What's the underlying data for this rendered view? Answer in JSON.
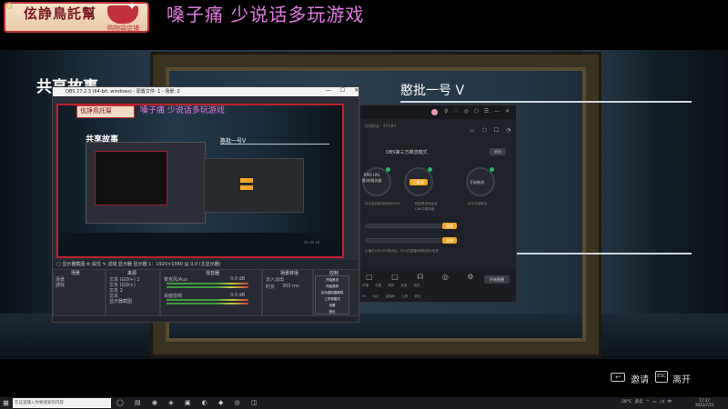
{
  "banner": {
    "logo_text": "伭諍鳥託幫",
    "logo_sub": "购物袋店铺",
    "title": "嗓子痛 少说话多玩游戏"
  },
  "scene": {
    "heading_left": "共享故事",
    "heading_right": "憨批一号 ᐯ"
  },
  "obs": {
    "title": "OBS 27.2.3 (64-bit, windows) - 配置文件: 1 - 场景: 2",
    "win_buttons": "— ☐ ✕",
    "preview": {
      "logo_text": "伭諍鳥託幫",
      "title": "嗓子痛 少说话多玩游戏",
      "heading_left": "共享故事",
      "heading_right": "憨批一号ᐯ",
      "buttons": "▭ ▭ ▭"
    },
    "toolbar_text": "▢ 显示器截图    ⚙ 属性   ✎ 滤镜   显示器   显示器 1：1920×1080 @ 0,0 (主显示器)",
    "docks": {
      "scenes": {
        "header": "场景",
        "items": [
          "场景",
          "游戏"
        ]
      },
      "sources": {
        "header": "来源",
        "items": [
          "文本 (GDI+) 2",
          "文本 (GDI+)",
          "文本 2",
          "文本",
          "显示器截图"
        ]
      },
      "mixer": {
        "header": "混音器",
        "items": [
          "麦克风/Aux",
          "桌面音频"
        ],
        "levels": [
          "0.0 dB",
          "0.0 dB"
        ]
      },
      "transitions": {
        "header": "场景转场",
        "items": [
          "淡入淡出",
          "时长",
          "300 ms"
        ]
      },
      "controls": {
        "header": "控制",
        "items": [
          "开始推流",
          "开始录制",
          "启动虚拟摄像机",
          "工作室模式",
          "设置",
          "退出"
        ]
      }
    }
  },
  "context_menu": {
    "items": [
      "开始推流",
      "开始录制",
      "启动虚拟摄像机",
      "工作室模式",
      "设置",
      "退出"
    ]
  },
  "game_assistant": {
    "title_icons": "♀ ♡ ◎ ⬡ ☰ — ✕",
    "sub": "在线好友 · 47/184",
    "sub_icons": "▭ ⬡ ☐ ◔ ⤴",
    "mode_text": "OBS第三方推流模式",
    "mode_btn": "退出",
    "circle1_t1": "RMS URL",
    "circle1_t2": "推流/服务器",
    "circle2_btn": "已复制",
    "circle3_t": "开始推流",
    "cap1": "点击复制推流地址到OBS",
    "cap2": "粘贴推流地址到",
    "cap3": "OBS中服务器",
    "cap4": "点击开始推流",
    "slider_btn1": "复制",
    "slider_btn2": "复制",
    "note": "主播可以在OBS推流后，可以在直播间获取观众信息",
    "bottom_icons": "▢ ▢ ☊ ◎ ⚙",
    "bottom_labels": [
      "开播",
      "设置",
      "美颜",
      "连麦",
      "装扮"
    ],
    "bottom_labels2": [
      "PK",
      "玩法",
      "直播间",
      "礼物",
      "更多"
    ],
    "start_btn": "开始直播"
  },
  "bottom_bar": {
    "invite_icon": "↩",
    "invite_label": "邀请",
    "esc_key": "ESC",
    "leave_label": "离开"
  },
  "taskbar": {
    "start_icon": "⊞",
    "search_placeholder": "在这里输入你要搜索的内容",
    "app_icons": "◯ ▤ ◉ ◈ ▣ ◐ ◆ ◎ ◫",
    "tray": "28°C 多云 ^ ▭ ◁) 中",
    "time": "17:37",
    "date": "2022/7/23"
  }
}
